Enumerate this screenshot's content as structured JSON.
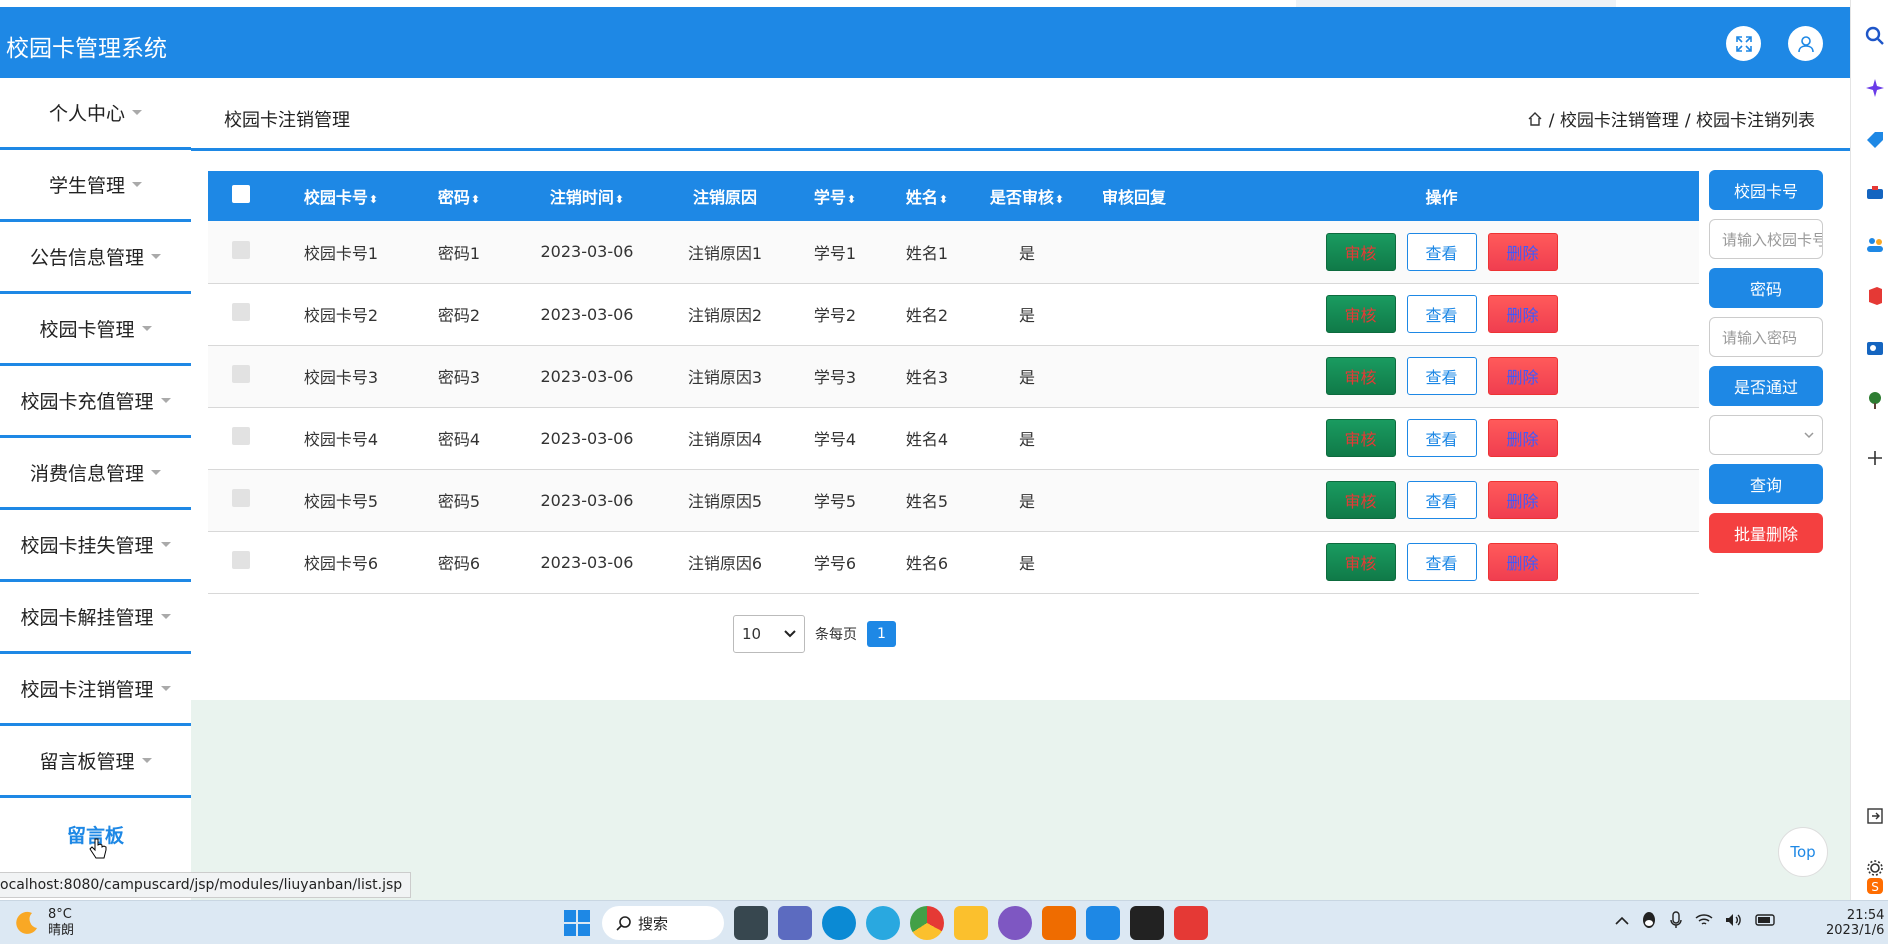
{
  "header": {
    "title": "校园卡管理系统"
  },
  "sidebar": {
    "items": [
      {
        "label": "个人中心"
      },
      {
        "label": "学生管理"
      },
      {
        "label": "公告信息管理"
      },
      {
        "label": "校园卡管理"
      },
      {
        "label": "校园卡充值管理"
      },
      {
        "label": "消费信息管理"
      },
      {
        "label": "校园卡挂失管理"
      },
      {
        "label": "校园卡解挂管理"
      },
      {
        "label": "校园卡注销管理"
      },
      {
        "label": "留言板管理"
      }
    ],
    "sub_item": "留言板"
  },
  "content": {
    "title": "校园卡注销管理",
    "breadcrumb": [
      "/ 校园卡注销管理",
      "/ 校园卡注销列表"
    ]
  },
  "table": {
    "headers": {
      "card_no": "校园卡号",
      "password": "密码",
      "cancel_time": "注销时间",
      "reason": "注销原因",
      "student_no": "学号",
      "name": "姓名",
      "audited": "是否审核",
      "reply": "审核回复",
      "ops": "操作"
    },
    "sort_glyph": "⬍",
    "rows": [
      {
        "card_no": "校园卡号1",
        "password": "密码1",
        "cancel_time": "2023-03-06",
        "reason": "注销原因1",
        "student_no": "学号1",
        "name": "姓名1",
        "audited": "是",
        "reply": ""
      },
      {
        "card_no": "校园卡号2",
        "password": "密码2",
        "cancel_time": "2023-03-06",
        "reason": "注销原因2",
        "student_no": "学号2",
        "name": "姓名2",
        "audited": "是",
        "reply": ""
      },
      {
        "card_no": "校园卡号3",
        "password": "密码3",
        "cancel_time": "2023-03-06",
        "reason": "注销原因3",
        "student_no": "学号3",
        "name": "姓名3",
        "audited": "是",
        "reply": ""
      },
      {
        "card_no": "校园卡号4",
        "password": "密码4",
        "cancel_time": "2023-03-06",
        "reason": "注销原因4",
        "student_no": "学号4",
        "name": "姓名4",
        "audited": "是",
        "reply": ""
      },
      {
        "card_no": "校园卡号5",
        "password": "密码5",
        "cancel_time": "2023-03-06",
        "reason": "注销原因5",
        "student_no": "学号5",
        "name": "姓名5",
        "audited": "是",
        "reply": ""
      },
      {
        "card_no": "校园卡号6",
        "password": "密码6",
        "cancel_time": "2023-03-06",
        "reason": "注销原因6",
        "student_no": "学号6",
        "name": "姓名6",
        "audited": "是",
        "reply": ""
      }
    ],
    "actions": {
      "audit": "审核",
      "view": "查看",
      "delete": "删除"
    }
  },
  "pagination": {
    "page_size": "10",
    "per_page_label": "条每页",
    "current_page": "1"
  },
  "search_panel": {
    "card_label": "校园卡号",
    "card_placeholder": "请输入校园卡号",
    "password_label": "密码",
    "password_placeholder": "请输入密码",
    "passed_label": "是否通过",
    "query_button": "查询",
    "batch_delete_button": "批量删除"
  },
  "top_button": "Top",
  "status_url": "ocalhost:8080/campuscard/jsp/modules/liuyanban/list.jsp",
  "taskbar": {
    "weather_temp": "8°C",
    "weather_desc": "晴朗",
    "search_label": "搜索",
    "clock_time": "21:54",
    "clock_date": "2023/1/6"
  },
  "colors": {
    "primary": "#1e88e5",
    "danger": "#f44040",
    "success": "#107a48"
  }
}
